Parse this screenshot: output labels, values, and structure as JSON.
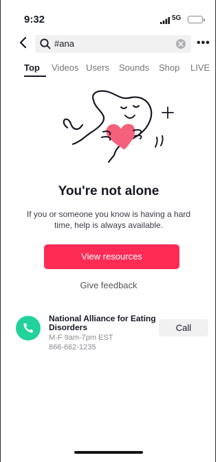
{
  "status_bar": {
    "time": "9:32",
    "network": "5G"
  },
  "search": {
    "query": "#ana",
    "more_icon": "more-horizontal-icon"
  },
  "tabs": [
    {
      "label": "Top",
      "active": true
    },
    {
      "label": "Videos"
    },
    {
      "label": "Users"
    },
    {
      "label": "Sounds"
    },
    {
      "label": "Shop"
    },
    {
      "label": "LIVE"
    }
  ],
  "support": {
    "headline": "You're not alone",
    "message": "If you or someone you know is having a hard time, help is always available.",
    "primary_button": "View resources",
    "feedback_link": "Give feedback"
  },
  "resource": {
    "name": "National Alliance for Eating Disorders",
    "hours": "M-F 9am-7pm EST",
    "phone": "866-662-1235",
    "call_label": "Call",
    "icon": "phone-icon",
    "icon_color": "#21d29a"
  },
  "colors": {
    "accent": "#fe2c55"
  }
}
